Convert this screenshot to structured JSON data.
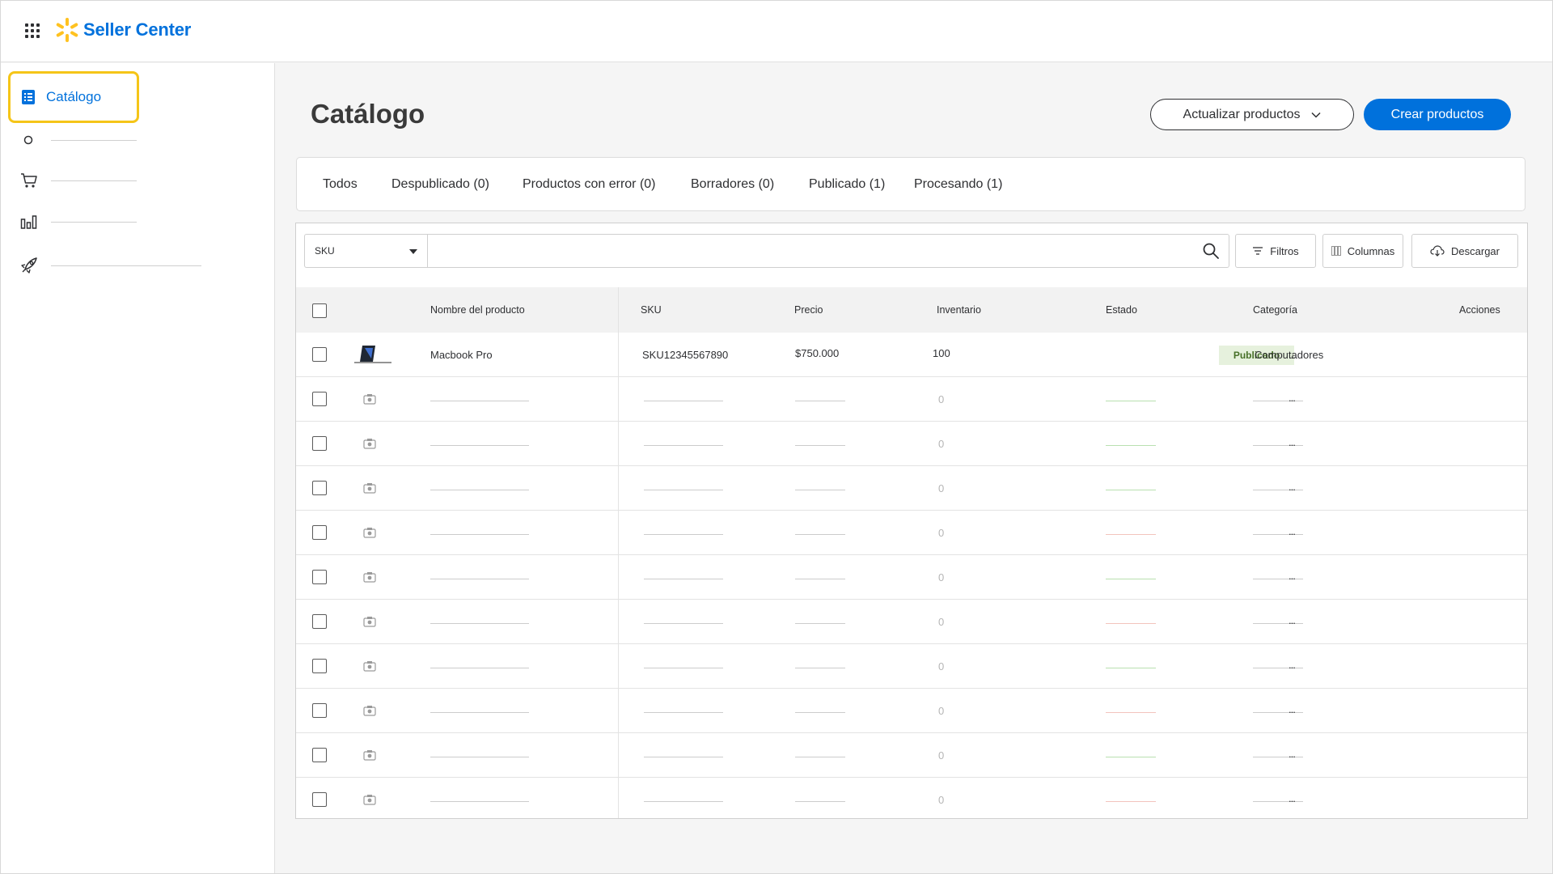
{
  "app": {
    "brand_name": "Seller Center",
    "brand_color": "#0071dc",
    "spark_color": "#ffc220"
  },
  "sidebar": {
    "active_item": {
      "label": "Catálogo",
      "icon": "list-icon"
    },
    "items": [
      {
        "icon": "circle-icon"
      },
      {
        "icon": "cart-icon"
      },
      {
        "icon": "bar-chart-icon"
      },
      {
        "icon": "rocket-icon"
      }
    ]
  },
  "page": {
    "title": "Catálogo",
    "update_button": "Actualizar productos",
    "create_button": "Crear productos"
  },
  "tabs": [
    "Todos",
    "Despublicado (0)",
    "Productos con error (0)",
    "Borradores (0)",
    "Publicado (1)",
    "Procesando (1)"
  ],
  "toolbar": {
    "search_field_select": "SKU",
    "search_value": "",
    "filters_label": "Filtros",
    "columns_label": "Columnas",
    "download_label": "Descargar"
  },
  "table": {
    "columns": [
      "Nombre del producto",
      "SKU",
      "Precio",
      "Inventario",
      "Estado",
      "Categoría",
      "Acciones"
    ],
    "product": {
      "name": "Macbook Pro",
      "sku": "SKU12345567890",
      "price": "$750.000",
      "inventory": "100",
      "status": "Publicado",
      "category": "Computadores",
      "actions": "..."
    },
    "placeholder_rows": [
      {
        "inventory": "0",
        "status_color": "#b9e0b0",
        "actions": "..."
      },
      {
        "inventory": "0",
        "status_color": "#b9e0b0",
        "actions": "..."
      },
      {
        "inventory": "0",
        "status_color": "#b9e0b0",
        "actions": "..."
      },
      {
        "inventory": "0",
        "status_color": "#f3c4bd",
        "actions": "..."
      },
      {
        "inventory": "0",
        "status_color": "#b9e0b0",
        "actions": "..."
      },
      {
        "inventory": "0",
        "status_color": "#f3c4bd",
        "actions": "..."
      },
      {
        "inventory": "0",
        "status_color": "#b9e0b0",
        "actions": "..."
      },
      {
        "inventory": "0",
        "status_color": "#f3c4bd",
        "actions": "..."
      },
      {
        "inventory": "0",
        "status_color": "#b9e0b0",
        "actions": "..."
      },
      {
        "inventory": "0",
        "status_color": "#f3c4bd",
        "actions": "..."
      }
    ]
  }
}
